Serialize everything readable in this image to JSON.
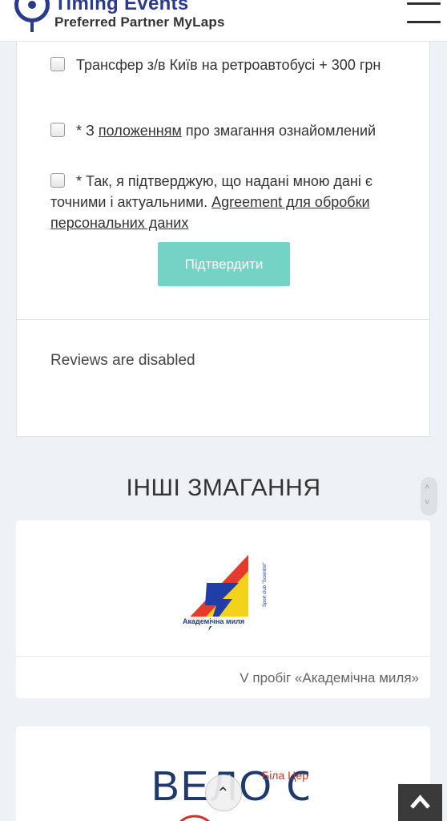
{
  "header": {
    "logo_title": "Timing Events",
    "logo_subtitle": "Preferred Partner MyLaps"
  },
  "form": {
    "options": [
      {
        "text": "Трансфер з/в Київ на ретроавтобусі + 300 грн"
      },
      {
        "prefix": "* З ",
        "link": "положенням",
        "suffix": " про змагання ознайомлений"
      },
      {
        "text": "* Так, я підтверджую, що надані мною дані є точними і актуальними. ",
        "link": "Agreement для обробки персональних даних"
      }
    ],
    "submit_label": "Підтвердити"
  },
  "reviews_text": "Reviews are disabled",
  "other_events": {
    "title": "ІНШІ ЗМАГАННЯ",
    "items": [
      {
        "caption": "V пробіг «Академічна миля»",
        "logo_text": "Академічна миля",
        "logo_side_text": "Sport club \"Scientist\""
      },
      {
        "caption": "",
        "logo_text": "ВЕЛО СОТКА",
        "logo_side_text": "Біла Церква"
      }
    ]
  },
  "colors": {
    "accent": "#74d3c5",
    "brand": "#2a3a8c"
  },
  "icons": {
    "menu": "hamburger-icon",
    "back_to_top": "chevron-up-icon",
    "scroll_up": "caret-up-icon"
  }
}
